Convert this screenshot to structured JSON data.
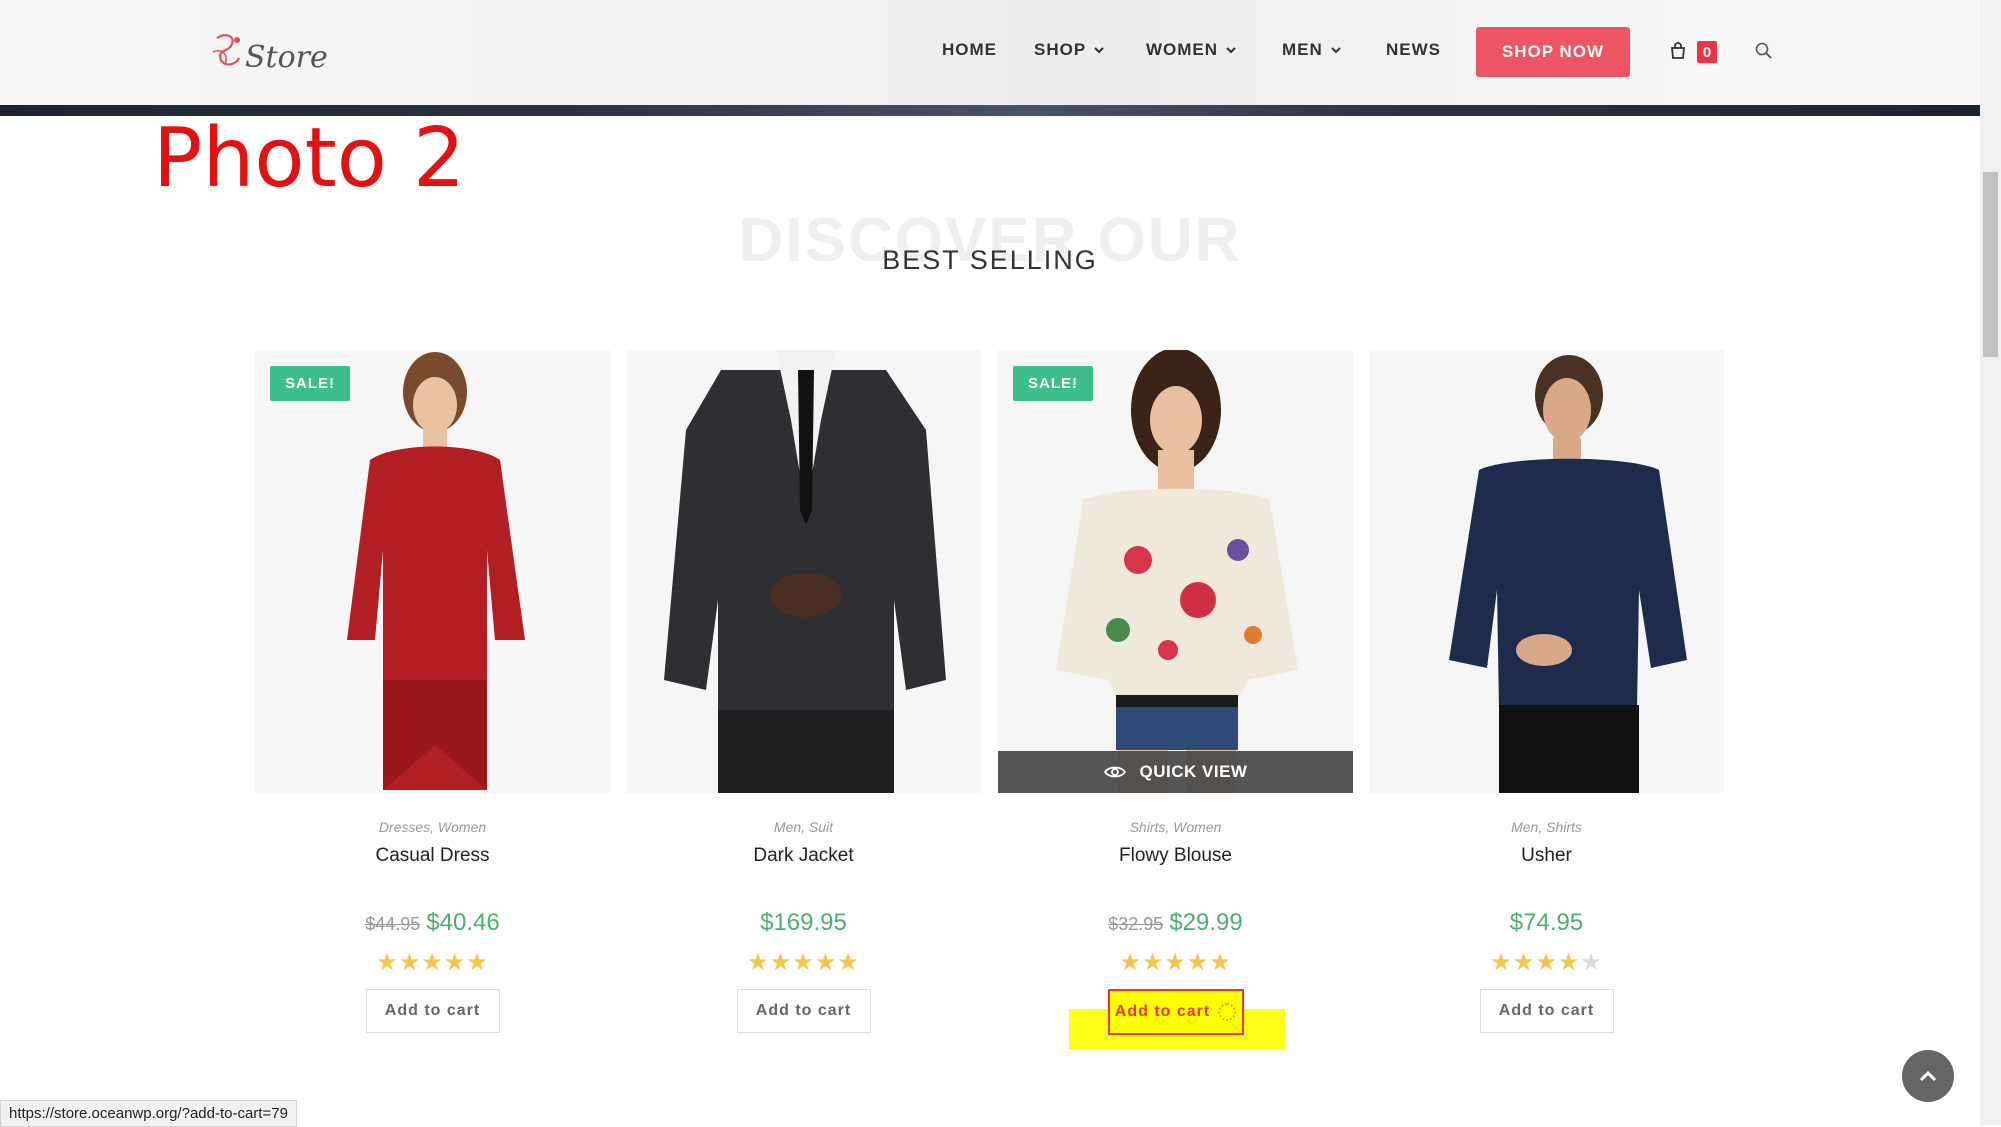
{
  "header": {
    "logo_text": "Store",
    "nav": [
      {
        "label": "HOME"
      },
      {
        "label": "SHOP"
      },
      {
        "label": "WOMEN"
      },
      {
        "label": "MEN"
      },
      {
        "label": "NEWS"
      }
    ],
    "cta_label": "SHOP NOW",
    "cart_count": "0"
  },
  "annotation": "Photo 2",
  "section": {
    "bg_title": "DISCOVER OUR",
    "title": "BEST SELLING"
  },
  "products": [
    {
      "sale": "SALE!",
      "categories": "Dresses, Women",
      "name": "Casual Dress",
      "old_price": "$44.95",
      "price": "$40.46",
      "rating": 5,
      "button": "Add to cart"
    },
    {
      "sale": "",
      "categories": "Men, Suit",
      "name": "Dark Jacket",
      "old_price": "",
      "price": "$169.95",
      "rating": 5,
      "button": "Add to cart"
    },
    {
      "sale": "SALE!",
      "categories": "Shirts, Women",
      "name": "Flowy Blouse",
      "old_price": "$32.95",
      "price": "$29.99",
      "rating": 5,
      "button": "Add to cart",
      "quick_view": "QUICK VIEW"
    },
    {
      "sale": "",
      "categories": "Men, Shirts",
      "name": "Usher",
      "old_price": "",
      "price": "$74.95",
      "rating": 4,
      "button": "Add to cart"
    }
  ],
  "status_url": "https://store.oceanwp.org/?add-to-cart=79",
  "colors": {
    "accent": "#ee5563",
    "price": "#4cb06b",
    "sale": "#3dbf8a",
    "annotation": "#e31111",
    "highlight": "#ffff1a"
  }
}
